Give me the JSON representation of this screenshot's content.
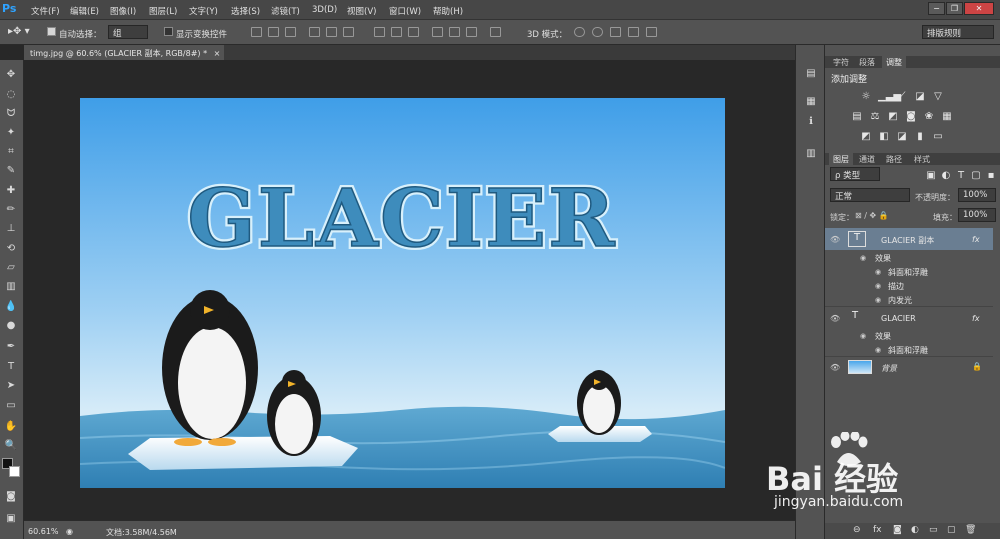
{
  "app": {
    "logo": "Ps"
  },
  "menu": [
    "文件(F)",
    "编辑(E)",
    "图像(I)",
    "图层(L)",
    "文字(Y)",
    "选择(S)",
    "滤镜(T)",
    "3D(D)",
    "视图(V)",
    "窗口(W)",
    "帮助(H)"
  ],
  "window_controls": [
    "−",
    "❐",
    "✕"
  ],
  "options": {
    "auto_select_label": "自动选择：",
    "auto_select_value": "组",
    "show_transform_label": "显示变换控件",
    "mode_3d_label": "3D 模式：",
    "workspace": "排版规则"
  },
  "document_tab": {
    "title": "timg.jpg @ 60.6% (GLACIER 副本, RGB/8#) *",
    "close": "×"
  },
  "canvas": {
    "headline": "GLACIER",
    "colors": {
      "sky_top": "#4aa6ea",
      "sky_bottom": "#cfe6f6",
      "sea": "#3f8fc0",
      "text_fill": "#3e8cbc",
      "text_outline": "#1f5a80"
    }
  },
  "status": {
    "zoom": "60.61%",
    "doc_info": "文档:3.58M/4.56M"
  },
  "panel_top": {
    "tabs": [
      "字符",
      "段落",
      "调整"
    ],
    "active_tab": "调整",
    "title": "添加调整"
  },
  "panel_layers": {
    "tabs": [
      "图层",
      "通道",
      "路径",
      "样式"
    ],
    "filter_label": "ρ 类型",
    "blend_mode": "正常",
    "opacity_label": "不透明度：",
    "opacity_value": "100%",
    "lock_label": "锁定：",
    "fill_label": "填充：",
    "fill_value": "100%",
    "layers": [
      {
        "name": "GLACIER 副本",
        "type": "T",
        "fx": "fx",
        "effects_label": "效果",
        "effects": [
          "斜面和浮雕",
          "描边",
          "内发光"
        ]
      },
      {
        "name": "GLACIER",
        "type": "T",
        "fx": "fx",
        "effects_label": "效果",
        "effects": [
          "斜面和浮雕"
        ]
      },
      {
        "name": "背景",
        "type": "image",
        "lock": "🔒"
      }
    ]
  },
  "watermark": {
    "brand": "Bai 经验",
    "url": "jingyan.baidu.com"
  }
}
